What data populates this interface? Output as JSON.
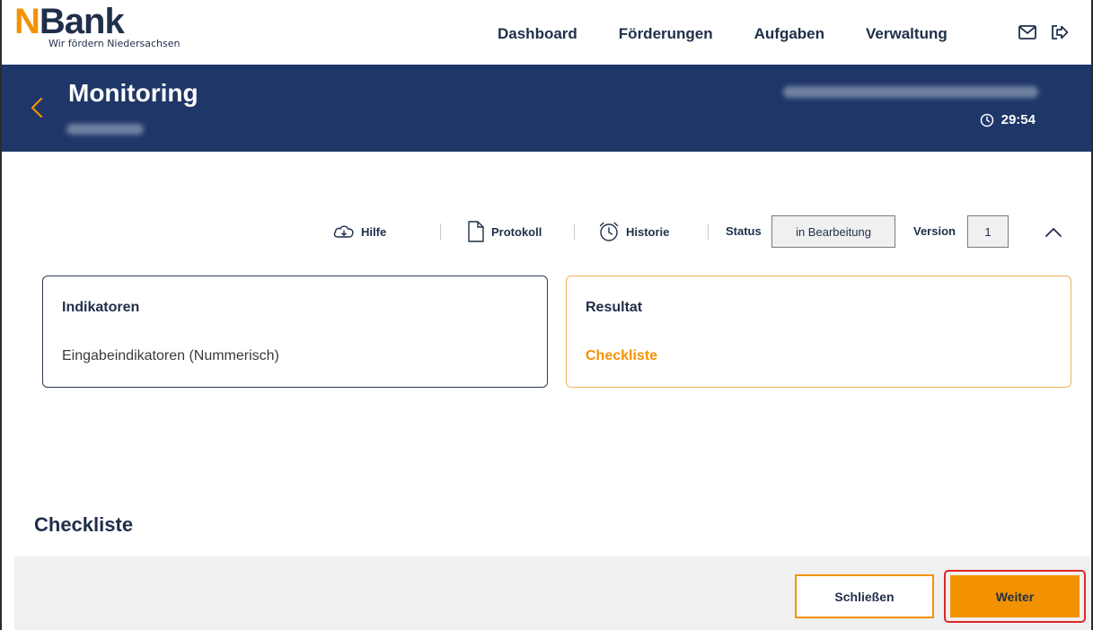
{
  "header": {
    "logo_text_accent": "N",
    "logo_text_rest": "Bank",
    "logo_tagline": "Wir fördern Niedersachsen",
    "nav": [
      {
        "label": "Dashboard"
      },
      {
        "label": "Förderungen"
      },
      {
        "label": "Aufgaben"
      },
      {
        "label": "Verwaltung"
      }
    ],
    "icons": [
      "mail-icon",
      "logout-icon"
    ]
  },
  "banner": {
    "title": "Monitoring",
    "timer": "29:54",
    "colors": {
      "background": "#1f3668",
      "back_arrow": "#f39200"
    }
  },
  "toolbar": {
    "help_label": "Hilfe",
    "protocol_label": "Protokoll",
    "history_label": "Historie",
    "status_label": "Status",
    "status_value": "in Bearbeitung",
    "version_label": "Version",
    "version_value": "1"
  },
  "cards": {
    "indicators": {
      "title": "Indikatoren",
      "item": "Eingabeindikatoren (Nummerisch)"
    },
    "result": {
      "title": "Resultat",
      "link": "Checkliste"
    }
  },
  "section": {
    "heading": "Checkliste"
  },
  "footer": {
    "close_label": "Schließen",
    "next_label": "Weiter"
  },
  "colors": {
    "accent": "#f39200",
    "navy": "#1f2f4a",
    "highlight_border": "#e0262a"
  }
}
